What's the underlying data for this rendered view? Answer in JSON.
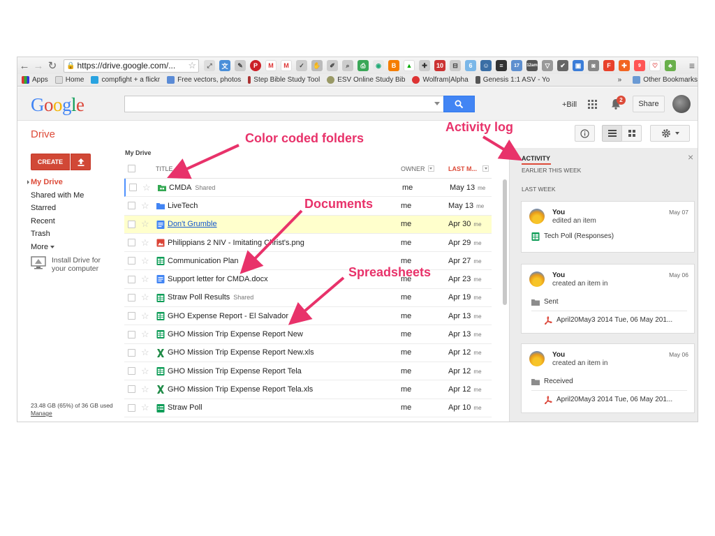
{
  "browser": {
    "url": "https://drive.google.com/...",
    "bookmarks": [
      {
        "label": "Apps"
      },
      {
        "label": "Home"
      },
      {
        "label": "compfight + a flickr"
      },
      {
        "label": "Free vectors, photos"
      },
      {
        "label": "Step Bible Study Tool"
      },
      {
        "label": "ESV Online Study Bib"
      },
      {
        "label": "Wolfram|Alpha"
      },
      {
        "label": "Genesis 1:1 ASV - Yo"
      },
      {
        "label": "Other Bookmarks"
      }
    ],
    "bookmarks_overflow": "»",
    "badges": {
      "ext1": "10",
      "ext2": "17",
      "ext3": "12am",
      "ext4": "9"
    }
  },
  "header": {
    "logo": "Google",
    "plus_user": "+Bill",
    "notification_count": "2",
    "share_label": "Share"
  },
  "drive": {
    "title": "Drive",
    "create_label": "CREATE",
    "nav": [
      {
        "label": "My Drive",
        "active": true
      },
      {
        "label": "Shared with Me"
      },
      {
        "label": "Starred"
      },
      {
        "label": "Recent"
      },
      {
        "label": "Trash"
      },
      {
        "label": "More"
      }
    ],
    "install_label": "Install Drive for your computer",
    "storage_text": "23.48 GB (65%) of 36 GB used",
    "manage_label": "Manage"
  },
  "files": {
    "breadcrumb": "My Drive",
    "columns": {
      "title": "TITLE",
      "owner": "OWNER",
      "modified": "LAST M..."
    },
    "rows": [
      {
        "name": "CMDA",
        "shared": "Shared",
        "type": "folder-green",
        "owner": "me",
        "date": "May 13",
        "by": "me"
      },
      {
        "name": "LiveTech",
        "shared": "",
        "type": "folder-blue",
        "owner": "me",
        "date": "May 13",
        "by": "me"
      },
      {
        "name": "Don't Grumble",
        "shared": "",
        "type": "doc",
        "owner": "me",
        "date": "Apr 30",
        "by": "me"
      },
      {
        "name": "Philippians 2 NIV - Imitating Christ's.png",
        "shared": "",
        "type": "image",
        "owner": "me",
        "date": "Apr 29",
        "by": "me"
      },
      {
        "name": "Communication Plan",
        "shared": "",
        "type": "sheet",
        "owner": "me",
        "date": "Apr 27",
        "by": "me"
      },
      {
        "name": "Support letter for CMDA.docx",
        "shared": "",
        "type": "doc",
        "owner": "me",
        "date": "Apr 23",
        "by": "me"
      },
      {
        "name": "Straw Poll Results",
        "shared": "Shared",
        "type": "sheet",
        "owner": "me",
        "date": "Apr 19",
        "by": "me"
      },
      {
        "name": "GHO Expense Report - El Salvador",
        "shared": "",
        "type": "sheet",
        "owner": "me",
        "date": "Apr 13",
        "by": "me"
      },
      {
        "name": "GHO Mission Trip Expense Report New",
        "shared": "",
        "type": "sheet",
        "owner": "me",
        "date": "Apr 13",
        "by": "me"
      },
      {
        "name": "GHO Mission Trip Expense Report New.xls",
        "shared": "",
        "type": "excel",
        "owner": "me",
        "date": "Apr 12",
        "by": "me"
      },
      {
        "name": "GHO Mission Trip Expense Report Tela",
        "shared": "",
        "type": "sheet",
        "owner": "me",
        "date": "Apr 12",
        "by": "me"
      },
      {
        "name": "GHO Mission Trip Expense Report Tela.xls",
        "shared": "",
        "type": "excel",
        "owner": "me",
        "date": "Apr 12",
        "by": "me"
      },
      {
        "name": "Straw Poll",
        "shared": "",
        "type": "form",
        "owner": "me",
        "date": "Apr 10",
        "by": "me"
      }
    ]
  },
  "activity": {
    "title": "ACTIVITY",
    "close": "×",
    "sections": {
      "earlier": "EARLIER THIS WEEK",
      "last_week": "LAST WEEK"
    },
    "cards": [
      {
        "who": "You",
        "when": "May 07",
        "what": "edited an item",
        "items": [
          {
            "label": "Tech Poll (Responses)",
            "type": "sheet"
          }
        ]
      },
      {
        "who": "You",
        "when": "May 06",
        "what": "created an item in",
        "items": [
          {
            "label": "Sent",
            "type": "folder-grey"
          },
          {
            "label": "April20May3 2014 Tue, 06 May 201...",
            "type": "pdf"
          }
        ]
      },
      {
        "who": "You",
        "when": "May 06",
        "what": "created an item in",
        "items": [
          {
            "label": "Received",
            "type": "folder-grey"
          },
          {
            "label": "April20May3 2014 Tue, 06 May 201...",
            "type": "pdf"
          }
        ]
      }
    ]
  },
  "annotations": {
    "folders": "Color coded folders",
    "activity": "Activity log",
    "documents": "Documents",
    "spreadsheets": "Spreadsheets"
  },
  "colors": {
    "drive_red": "#dd4b39",
    "search_blue": "#4285f4",
    "annotation_pink": "#e8326a",
    "sheet_green": "#0f9d58",
    "doc_blue": "#4285f4"
  }
}
